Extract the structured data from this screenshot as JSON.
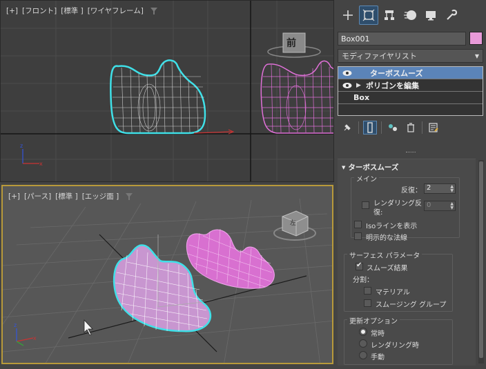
{
  "viewports": {
    "front": {
      "label_plus": "[+]",
      "label_view": "[フロント]",
      "label_shading": "[標準 ]",
      "label_mode": "[ワイヤフレーム]",
      "viewcube_text": "前"
    },
    "perspective": {
      "label_plus": "[+]",
      "label_view": "[パース]",
      "label_shading": "[標準 ]",
      "label_mode": "[エッジ面 ]",
      "viewcube_text": "左"
    }
  },
  "panel": {
    "tabs": [
      "create-icon",
      "modify-icon",
      "hierarchy-icon",
      "motion-icon",
      "display-icon",
      "utilities-icon"
    ],
    "object_name": "Box001",
    "object_color": "#e89ad8",
    "modifier_list": "モディファイヤリスト",
    "stack": {
      "item1": "ターボスムーズ",
      "item2": "ポリゴンを編集",
      "item3": "Box"
    },
    "rollout": {
      "title": "ターボスムーズ",
      "main_group": "メイン",
      "iterations_label": "反復：",
      "iterations_value": "2",
      "render_iter_label1": "レンダリング反",
      "render_iter_label2": "復:",
      "render_iter_value": "0",
      "iso_label": "Isoラインを表示",
      "explicit_normals_label": "明示的な法線",
      "surface_group": "サーフェス パラメータ",
      "smooth_result_label": "スムーズ結果",
      "separate_label": "分割：",
      "material_label": "マテリアル",
      "smoothing_group_label": "スムージング グループ",
      "update_group": "更新オプション",
      "always_label": "常時",
      "when_rendering_label": "レンダリング時",
      "manual_label": "手動"
    }
  },
  "colors": {
    "accent": "#5b84b8",
    "selection_wire": "#3fe0e8",
    "object_pink": "#e070d8",
    "active_viewport_border": "#b99a3a"
  }
}
